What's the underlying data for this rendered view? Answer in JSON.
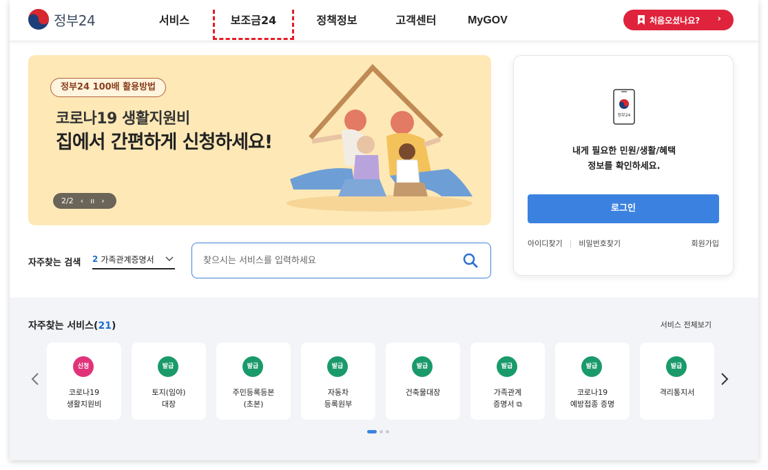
{
  "header": {
    "logo_text": "정부24",
    "nav": [
      "서비스",
      "보조금24",
      "정책정보",
      "고객센터",
      "MyGOV"
    ],
    "first_visit_button": "처음오셨나요?"
  },
  "banner": {
    "tag": "정부24 100배 활용방법",
    "title_line1": "코로나19 생활지원비",
    "title_line2": "집에서 간편하게 신청하세요!",
    "pager": "2/2"
  },
  "search": {
    "freq_label": "자주찾는 검색",
    "freq_num": "2",
    "freq_value": "가족관계증명서",
    "placeholder": "찾으시는 서비스를 입력하세요"
  },
  "login": {
    "message_line1": "내게 필요한 민원/생활/혜택",
    "message_line2": "정보를 확인하세요.",
    "phone_label": "정부24",
    "button": "로그인",
    "find_id": "아이디찾기",
    "find_pw": "비밀번호찾기",
    "join": "회원가입"
  },
  "services": {
    "title": "자주찾는 서비스",
    "count": "21",
    "view_all": "서비스 전체보기",
    "items": [
      {
        "badge": "신청",
        "badge_color": "#e0337a",
        "name": "코로나19\n생활지원비"
      },
      {
        "badge": "발급",
        "badge_color": "#1a9a6b",
        "name": "토지(임야)\n대장"
      },
      {
        "badge": "발급",
        "badge_color": "#1a9a6b",
        "name": "주민등록등본\n(초본)"
      },
      {
        "badge": "발급",
        "badge_color": "#1a9a6b",
        "name": "자동차\n등록원부"
      },
      {
        "badge": "발급",
        "badge_color": "#1a9a6b",
        "name": "건축물대장"
      },
      {
        "badge": "발급",
        "badge_color": "#1a9a6b",
        "name": "가족관계\n증명서 ⧉"
      },
      {
        "badge": "발급",
        "badge_color": "#1a9a6b",
        "name": "코로나19\n예방접종 증명"
      },
      {
        "badge": "발급",
        "badge_color": "#1a9a6b",
        "name": "격리통지서"
      }
    ]
  }
}
